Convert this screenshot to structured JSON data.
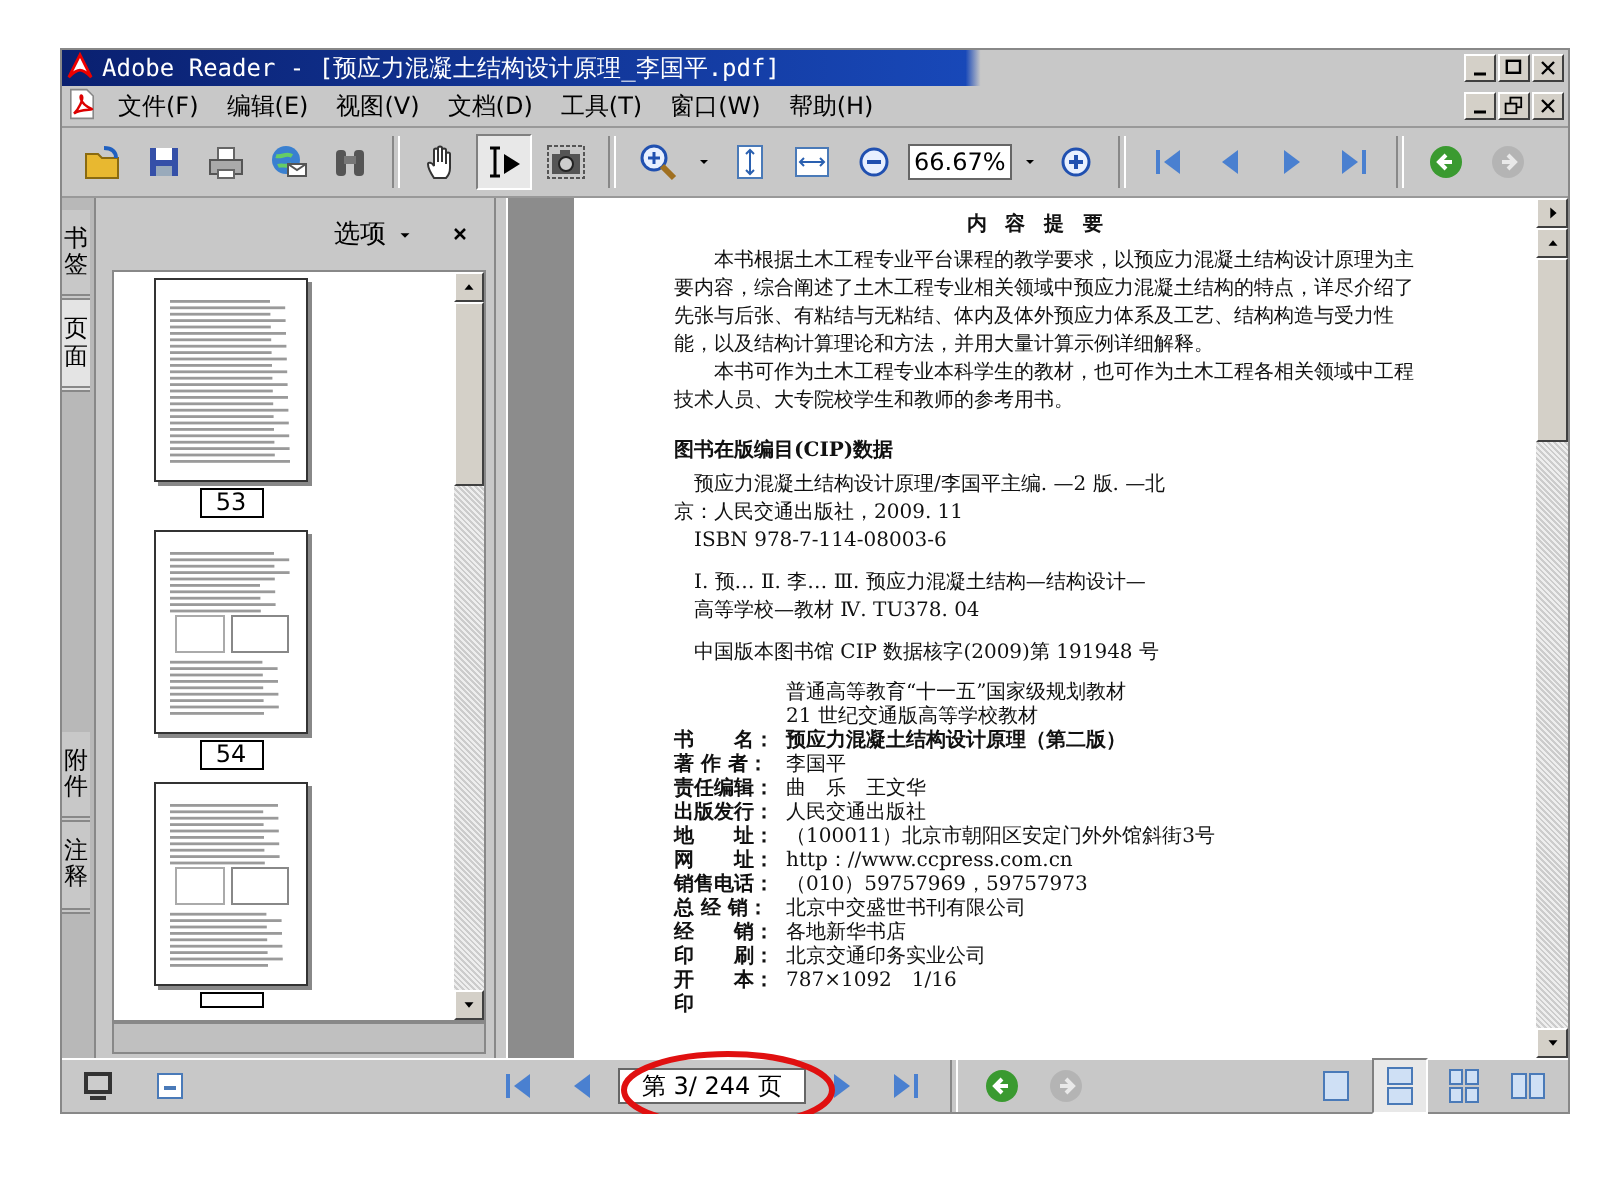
{
  "window": {
    "title": "Adobe Reader - [预应力混凝土结构设计原理_李国平.pdf]"
  },
  "menu": [
    "文件(F)",
    "编辑(E)",
    "视图(V)",
    "文档(D)",
    "工具(T)",
    "窗口(W)",
    "帮助(H)"
  ],
  "toolbar": [
    {
      "kind": "open",
      "selected": false,
      "disabled": false
    },
    {
      "kind": "save",
      "selected": false,
      "disabled": false
    },
    {
      "kind": "print",
      "selected": false,
      "disabled": false
    },
    {
      "kind": "email",
      "selected": false,
      "disabled": false
    },
    {
      "kind": "search",
      "selected": false,
      "disabled": false
    },
    {
      "kind": "separator"
    },
    {
      "kind": "hand",
      "selected": false,
      "disabled": false
    },
    {
      "kind": "select",
      "selected": true,
      "disabled": false
    },
    {
      "kind": "snapshot",
      "selected": false,
      "disabled": false
    },
    {
      "kind": "separator"
    },
    {
      "kind": "zoom_tool",
      "selected": false,
      "disabled": false
    },
    {
      "kind": "caret",
      "selected": false,
      "disabled": false
    },
    {
      "kind": "fit_page",
      "selected": false,
      "disabled": false
    },
    {
      "kind": "fit_width",
      "selected": false,
      "disabled": false
    },
    {
      "kind": "zoom_out",
      "selected": false,
      "disabled": false
    },
    {
      "kind": "zoom_field",
      "value": "66.67%"
    },
    {
      "kind": "caret",
      "selected": false,
      "disabled": false
    },
    {
      "kind": "zoom_in",
      "selected": false,
      "disabled": false
    },
    {
      "kind": "separator"
    },
    {
      "kind": "first",
      "selected": false,
      "disabled": false
    },
    {
      "kind": "prev",
      "selected": false,
      "disabled": false
    },
    {
      "kind": "next",
      "selected": false,
      "disabled": false
    },
    {
      "kind": "last",
      "selected": false,
      "disabled": false
    },
    {
      "kind": "separator"
    },
    {
      "kind": "back",
      "selected": false,
      "disabled": false
    },
    {
      "kind": "forward",
      "selected": false,
      "disabled": true
    }
  ],
  "side_tabs": [
    {
      "label": "书签",
      "selected": false
    },
    {
      "label": "页面",
      "selected": true
    },
    {
      "label": "附件",
      "selected": false
    },
    {
      "label": "注释",
      "selected": false
    }
  ],
  "panel": {
    "options": "选项",
    "thumbnails": [
      {
        "label": "53"
      },
      {
        "label": "54"
      },
      {
        "partial": true
      }
    ]
  },
  "document": {
    "title": "内 容 提 要",
    "paragraphs": [
      "本书根据土木工程专业平台课程的教学要求，以预应力混凝土结构设计原理为主要内容，综合阐述了土木工程专业相关领域中预应力混凝土结构的特点，详尽介绍了先张与后张、有粘结与无粘结、体内及体外预应力体系及工艺、结构构造与受力性能，以及结构计算理论和方法，并用大量计算示例详细解释。",
      "本书可作为土木工程专业本科学生的教材，也可作为土木工程各相关领域中工程技术人员、大专院校学生和教师的参考用书。"
    ],
    "cip_heading": "图书在版编目(CIP)数据",
    "cip_groups": [
      [
        {
          "text": "预应力混凝土结构设计原理/李国平主编. —2 版. —北",
          "indent": true
        },
        {
          "text": "京：人民交通出版社，2009. 11",
          "indent": false
        },
        {
          "text": "ISBN  978-7-114-08003-6",
          "indent": true
        }
      ],
      [
        {
          "text": "Ⅰ. 预…   Ⅱ. 李…   Ⅲ. 预应力混凝土结构—结构设计—",
          "indent": true
        },
        {
          "text": "高等学校—教材   Ⅳ. TU378. 04",
          "indent": true
        }
      ],
      [
        {
          "text": "中国版本图书馆 CIP 数据核字(2009)第 191948 号",
          "indent": true
        }
      ]
    ],
    "series": [
      "普通高等教育“十一五”国家级规划教材",
      "21 世纪交通版高等学校教材"
    ],
    "fields": [
      {
        "label": "书　　名：",
        "value": "预应力混凝土结构设计原理（第二版）",
        "bold": true
      },
      {
        "label": "著 作 者：",
        "value": "李国平",
        "bold": false
      },
      {
        "label": "责任编辑：",
        "value": "曲　乐　王文华",
        "bold": false
      },
      {
        "label": "出版发行：",
        "value": "人民交通出版社",
        "bold": false
      },
      {
        "label": "地　　址：",
        "value": "（100011）北京市朝阳区安定门外外馆斜街3号",
        "bold": false
      },
      {
        "label": "网　　址：",
        "value": "http：//www.ccpress.com.cn",
        "bold": false
      },
      {
        "label": "销售电话：",
        "value": "（010）59757969，59757973",
        "bold": false
      },
      {
        "label": "总 经 销：",
        "value": "北京中交盛世书刊有限公司",
        "bold": false
      },
      {
        "label": "经　　销：",
        "value": "各地新华书店",
        "bold": false
      },
      {
        "label": "印　　刷：",
        "value": "北京交通印务实业公司",
        "bold": false
      },
      {
        "label": "开　　本：",
        "value": "787×1092　1/16",
        "bold": false
      },
      {
        "label": "印"
      }
    ]
  },
  "status_bar": {
    "left": [
      {
        "kind": "monitor",
        "selected": false,
        "disabled": false
      },
      {
        "kind": "collapse",
        "selected": false,
        "disabled": false
      }
    ],
    "nav": [
      {
        "kind": "first",
        "selected": false,
        "disabled": false
      },
      {
        "kind": "prev",
        "selected": false,
        "disabled": false
      },
      {
        "kind": "page_field",
        "value": "第 3/ 244 页"
      },
      {
        "kind": "next",
        "selected": false,
        "disabled": false
      },
      {
        "kind": "last",
        "selected": false,
        "disabled": false
      },
      {
        "kind": "separator"
      },
      {
        "kind": "back",
        "selected": false,
        "disabled": false
      },
      {
        "kind": "forward",
        "selected": false,
        "disabled": true
      }
    ],
    "layouts": [
      {
        "kind": "single",
        "selected": false,
        "disabled": false
      },
      {
        "kind": "continuous",
        "selected": true,
        "disabled": false
      },
      {
        "kind": "continuous_facing",
        "selected": false,
        "disabled": false
      },
      {
        "kind": "facing",
        "selected": false,
        "disabled": false
      }
    ]
  },
  "highlight": {
    "kind": "ellipse"
  }
}
